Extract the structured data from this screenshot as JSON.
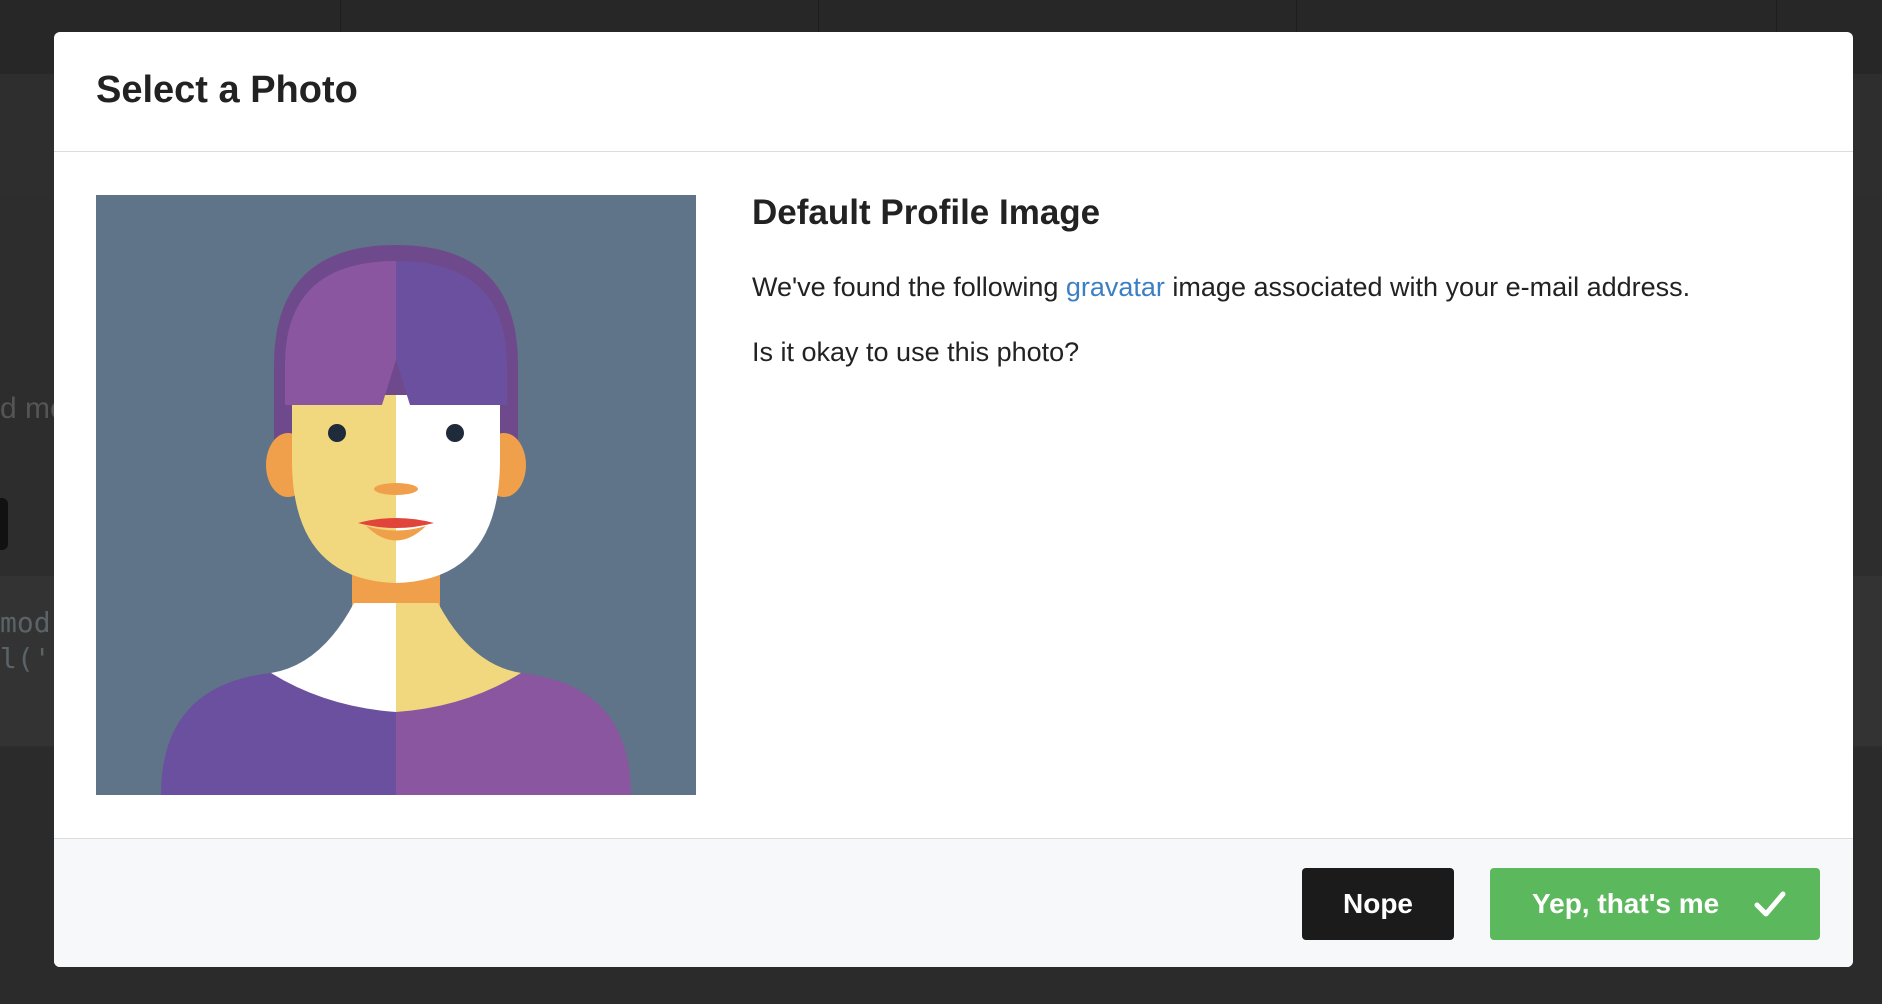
{
  "background": {
    "text_fragment": "d mo",
    "code_lines": [
      "mod",
      "l('"
    ]
  },
  "modal": {
    "title": "Select a Photo",
    "photo": {
      "icon": "gravatar-avatar-woman",
      "colors": {
        "background": "#5f7489",
        "hair_left": "#8a56a0",
        "hair_right": "#6a509e",
        "skin_left": "#f1d87f",
        "skin_right": "#ffffff",
        "neck": "#f0a04a",
        "shirt_left": "#6a509e",
        "shirt_right": "#8a56a0",
        "lips": "#e0443a"
      }
    },
    "info": {
      "title": "Default Profile Image",
      "text_before_link": "We've found the following ",
      "link_label": "gravatar",
      "text_after_link": " image associated with your e-mail address.",
      "question": "Is it okay to use this photo?"
    },
    "footer": {
      "nope_label": "Nope",
      "yes_label": "Yep, that's me",
      "yes_icon": "check-icon",
      "accent_color": "#5cb85c"
    }
  }
}
